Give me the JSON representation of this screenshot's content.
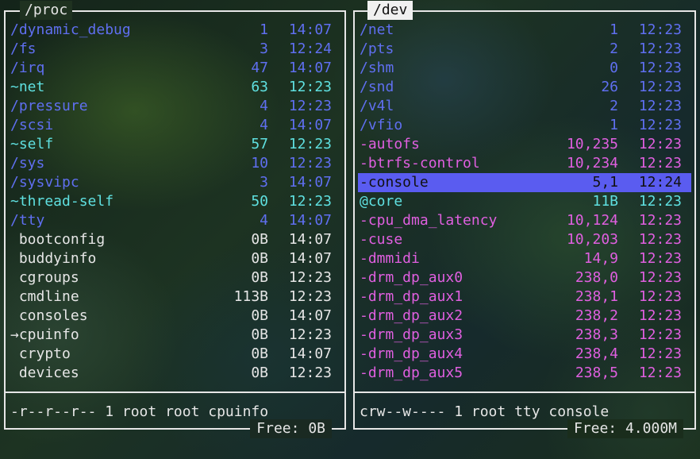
{
  "left_panel": {
    "title": "/proc",
    "rows": [
      {
        "name": "/dynamic_debug",
        "size": "1",
        "time": "14:07",
        "kind": "dir"
      },
      {
        "name": "/fs",
        "size": "3",
        "time": "12:24",
        "kind": "dir"
      },
      {
        "name": "/irq",
        "size": "47",
        "time": "14:07",
        "kind": "dir"
      },
      {
        "name": "~net",
        "size": "63",
        "time": "12:23",
        "kind": "link"
      },
      {
        "name": "/pressure",
        "size": "4",
        "time": "12:23",
        "kind": "dir"
      },
      {
        "name": "/scsi",
        "size": "4",
        "time": "14:07",
        "kind": "dir"
      },
      {
        "name": "~self",
        "size": "57",
        "time": "12:23",
        "kind": "link"
      },
      {
        "name": "/sys",
        "size": "10",
        "time": "12:23",
        "kind": "dir"
      },
      {
        "name": "/sysvipc",
        "size": "3",
        "time": "14:07",
        "kind": "dir"
      },
      {
        "name": "~thread-self",
        "size": "50",
        "time": "12:23",
        "kind": "link"
      },
      {
        "name": "/tty",
        "size": "4",
        "time": "14:07",
        "kind": "dir"
      },
      {
        "name": " bootconfig",
        "size": "0B",
        "time": "14:07",
        "kind": "file"
      },
      {
        "name": " buddyinfo",
        "size": "0B",
        "time": "14:07",
        "kind": "file"
      },
      {
        "name": " cgroups",
        "size": "0B",
        "time": "12:23",
        "kind": "file"
      },
      {
        "name": " cmdline",
        "size": "113B",
        "time": "12:23",
        "kind": "file"
      },
      {
        "name": " consoles",
        "size": "0B",
        "time": "14:07",
        "kind": "file"
      },
      {
        "name": "→cpuinfo",
        "size": "0B",
        "time": "12:23",
        "kind": "file"
      },
      {
        "name": " crypto",
        "size": "0B",
        "time": "14:07",
        "kind": "file"
      },
      {
        "name": " devices",
        "size": "0B",
        "time": "12:23",
        "kind": "file"
      }
    ],
    "info": "-r--r--r-- 1 root root cpuinfo",
    "free": "Free: 0B"
  },
  "right_panel": {
    "title": "/dev",
    "rows": [
      {
        "name": "/net",
        "size": "1",
        "time": "12:23",
        "kind": "dir"
      },
      {
        "name": "/pts",
        "size": "2",
        "time": "12:23",
        "kind": "dir"
      },
      {
        "name": "/shm",
        "size": "0",
        "time": "12:23",
        "kind": "dir"
      },
      {
        "name": "/snd",
        "size": "26",
        "time": "12:23",
        "kind": "dir"
      },
      {
        "name": "/v4l",
        "size": "2",
        "time": "12:23",
        "kind": "dir"
      },
      {
        "name": "/vfio",
        "size": "1",
        "time": "12:23",
        "kind": "dir"
      },
      {
        "name": "-autofs",
        "size": "10,235",
        "time": "12:23",
        "kind": "dev"
      },
      {
        "name": "-btrfs-control",
        "size": "10,234",
        "time": "12:23",
        "kind": "dev"
      },
      {
        "name": "-console",
        "size": "5,1",
        "time": "12:24",
        "kind": "dev",
        "selected": true
      },
      {
        "name": "@core",
        "size": "11B",
        "time": "12:23",
        "kind": "sock"
      },
      {
        "name": "-cpu_dma_latency",
        "size": "10,124",
        "time": "12:23",
        "kind": "dev"
      },
      {
        "name": "-cuse",
        "size": "10,203",
        "time": "12:23",
        "kind": "dev"
      },
      {
        "name": "-dmmidi",
        "size": "14,9",
        "time": "12:23",
        "kind": "dev"
      },
      {
        "name": "-drm_dp_aux0",
        "size": "238,0",
        "time": "12:23",
        "kind": "dev"
      },
      {
        "name": "-drm_dp_aux1",
        "size": "238,1",
        "time": "12:23",
        "kind": "dev"
      },
      {
        "name": "-drm_dp_aux2",
        "size": "238,2",
        "time": "12:23",
        "kind": "dev"
      },
      {
        "name": "-drm_dp_aux3",
        "size": "238,3",
        "time": "12:23",
        "kind": "dev"
      },
      {
        "name": "-drm_dp_aux4",
        "size": "238,4",
        "time": "12:23",
        "kind": "dev"
      },
      {
        "name": "-drm_dp_aux5",
        "size": "238,5",
        "time": "12:23",
        "kind": "dev"
      }
    ],
    "info": "crw--w---- 1 root tty console",
    "free": "Free: 4.000M"
  },
  "colors": {
    "dir": "#5f6ff0",
    "link": "#5fe0e0",
    "file": "#e6e6e6",
    "dev": "#e05fe0",
    "selection": "#5a5cf0"
  }
}
